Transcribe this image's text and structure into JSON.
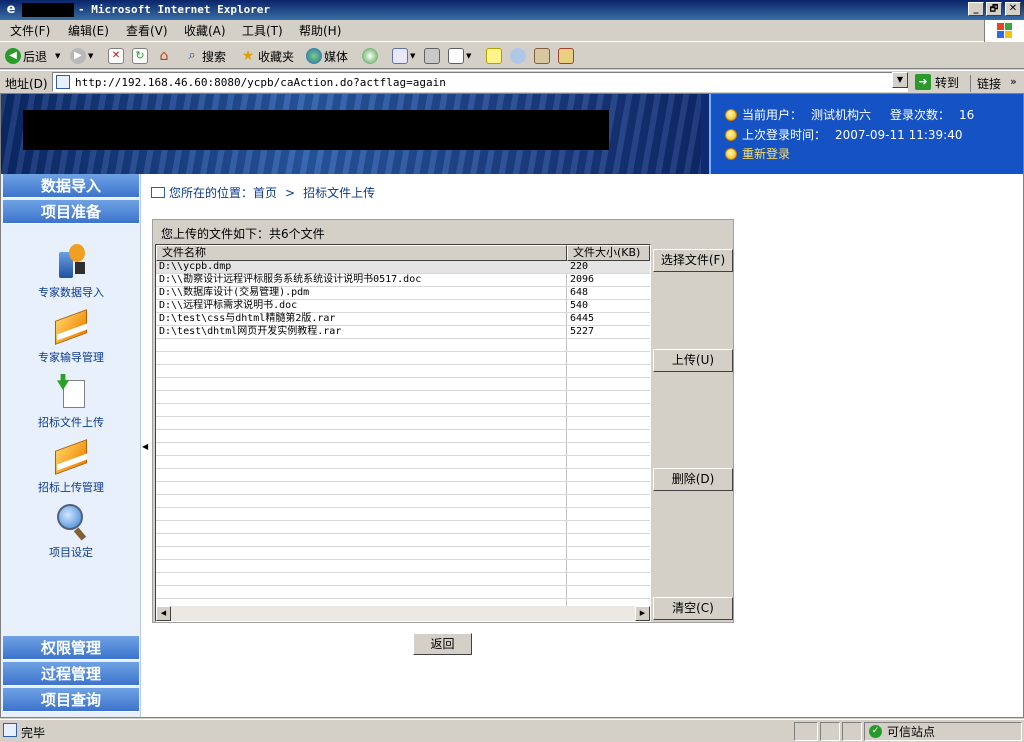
{
  "window": {
    "title": "- Microsoft Internet Explorer",
    "minimize": "_",
    "restore": "🗗",
    "close": "✕"
  },
  "menu": [
    "文件(F)",
    "编辑(E)",
    "查看(V)",
    "收藏(A)",
    "工具(T)",
    "帮助(H)"
  ],
  "toolbar": {
    "back": "后退",
    "search": "搜索",
    "favorites": "收藏夹",
    "media": "媒体"
  },
  "address": {
    "label": "地址(D)",
    "url": "http://192.168.46.60:8080/ycpb/caAction.do?actflag=again",
    "go": "转到",
    "links": "链接"
  },
  "header": {
    "current_user_label": "当前用户：",
    "current_user": "测试机构六",
    "login_count_label": "登录次数：",
    "login_count": "16",
    "last_login_label": "上次登录时间：",
    "last_login": "2007-09-11 11:39:40",
    "relogin": "重新登录"
  },
  "sidebar": {
    "top_sections": [
      "数据导入",
      "项目准备"
    ],
    "items": [
      {
        "label": "专家数据导入",
        "icon": "projector-icon"
      },
      {
        "label": "专家输导管理",
        "icon": "book-icon"
      },
      {
        "label": "招标文件上传",
        "icon": "upload-doc-icon"
      },
      {
        "label": "招标上传管理",
        "icon": "book-icon"
      },
      {
        "label": "项目设定",
        "icon": "magnifier-globe-icon"
      }
    ],
    "bottom_sections": [
      "权限管理",
      "过程管理",
      "项目查询"
    ]
  },
  "breadcrumb": {
    "prefix": "您所在的位置：首页",
    "sep": ">",
    "current": "招标文件上传"
  },
  "panel": {
    "caption": "您上传的文件如下：共6个文件",
    "columns": [
      "文件名称",
      "文件大小(KB)"
    ],
    "files": [
      {
        "name": "D:\\\\ycpb.dmp",
        "size": "220"
      },
      {
        "name": "D:\\\\勘察设计远程评标服务系统系统设计说明书0517.doc",
        "size": "2096"
      },
      {
        "name": "D:\\\\数据库设计(交易管理).pdm",
        "size": "648"
      },
      {
        "name": "D:\\\\远程评标需求说明书.doc",
        "size": "540"
      },
      {
        "name": "D:\\test\\css与dhtml精髓第2版.rar",
        "size": "6445"
      },
      {
        "name": "D:\\test\\dhtml网页开发实例教程.rar",
        "size": "5227"
      }
    ],
    "buttons": {
      "choose": "选择文件(F)",
      "upload": "上传(U)",
      "delete": "删除(D)",
      "clear": "清空(C)"
    }
  },
  "back_button": "返回",
  "status": {
    "text": "完毕",
    "zone": "可信站点"
  }
}
